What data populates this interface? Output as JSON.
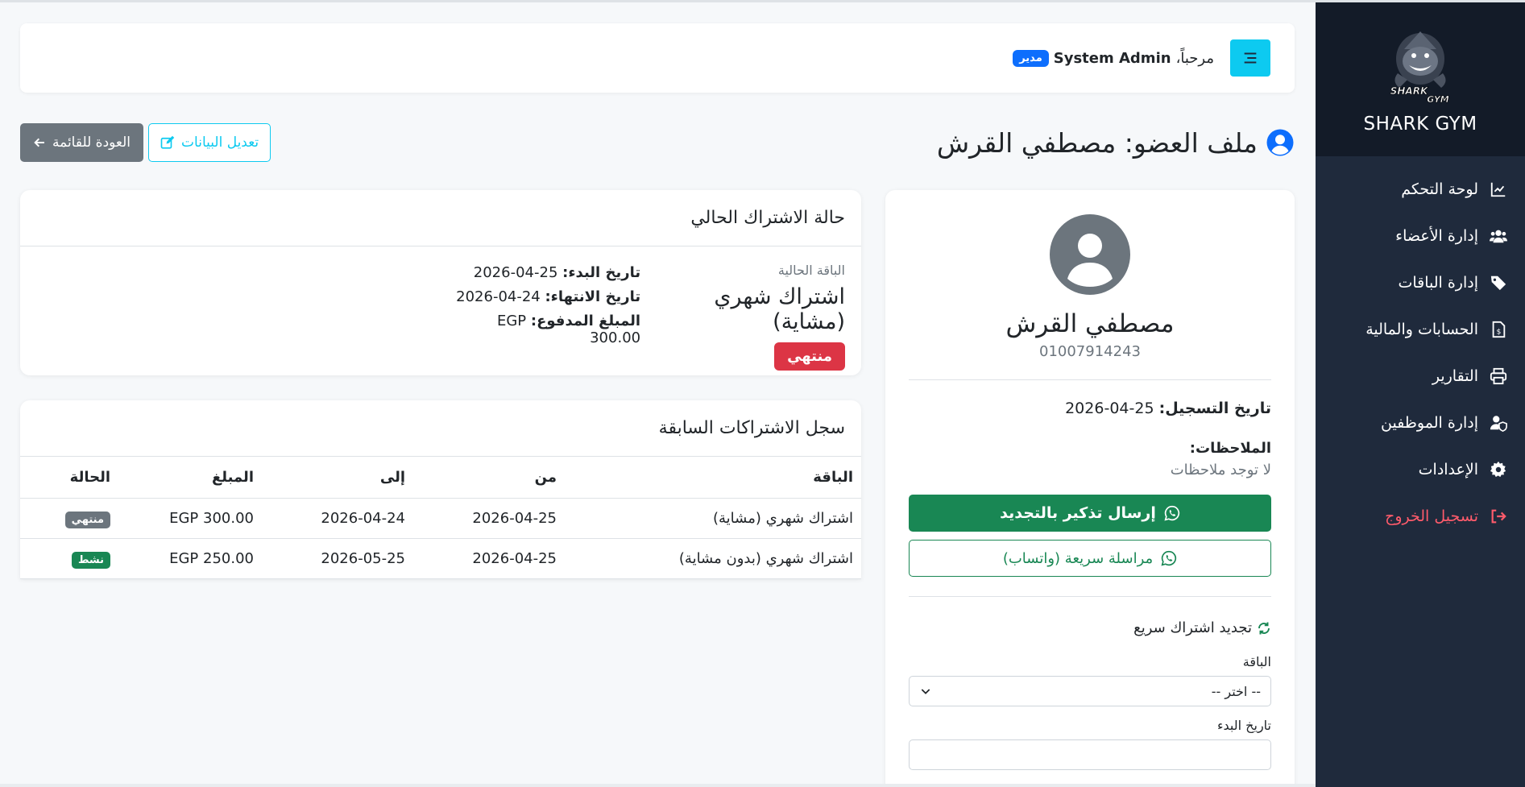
{
  "sidebar": {
    "brand": "SHARK GYM",
    "logo_text_top": "SHARK",
    "logo_text_bottom": "GYM",
    "items": [
      {
        "label": "لوحة التحكم",
        "icon": "chart-line-icon"
      },
      {
        "label": "إدارة الأعضاء",
        "icon": "users-icon"
      },
      {
        "label": "إدارة الباقات",
        "icon": "tags-icon"
      },
      {
        "label": "الحسابات والمالية",
        "icon": "invoice-dollar-icon"
      },
      {
        "label": "التقارير",
        "icon": "printer-icon"
      },
      {
        "label": "إدارة الموظفين",
        "icon": "user-shield-icon"
      },
      {
        "label": "الإعدادات",
        "icon": "gear-icon"
      },
      {
        "label": "تسجيل الخروج",
        "icon": "sign-out-icon"
      }
    ]
  },
  "topbar": {
    "greeting": "مرحباً،",
    "user": "System Admin",
    "role": "مدير"
  },
  "page": {
    "title": "ملف العضو: مصطفي القرش",
    "edit_label": "تعديل البيانات",
    "back_label": "العودة للقائمة"
  },
  "profile": {
    "name": "مصطفي القرش",
    "phone": "01007914243",
    "reg_label": "تاريخ التسجيل:",
    "reg_date": "25-04-2026",
    "notes_label": "الملاحظات:",
    "notes_value": "لا توجد ملاحظات",
    "reminder_label": "إرسال تذكير بالتجديد",
    "quick_msg_label": "مراسلة سريعة (واتساب)",
    "renew_title": "تجديد اشتراك سريع",
    "package_label": "الباقة",
    "package_select_value": "-- اختر --",
    "start_date_label": "تاريخ البدء"
  },
  "status": {
    "header": "حالة الاشتراك الحالي",
    "current_pkg_label": "الباقة الحالية",
    "current_pkg": "اشتراك شهري (مشاية)",
    "badge": "منتهي",
    "start_label": "تاريخ البدء:",
    "start_value": "25-04-2026",
    "end_label": "تاريخ الانتهاء:",
    "end_value": "24-04-2026",
    "paid_label": "المبلغ المدفوع:",
    "paid_value": "EGP 300.00"
  },
  "history": {
    "header": "سجل الاشتراكات السابقة",
    "columns": [
      "الباقة",
      "من",
      "إلى",
      "المبلغ",
      "الحالة"
    ],
    "rows": [
      {
        "pkg": "اشتراك شهري (مشاية)",
        "from": "2026-04-25",
        "to": "2026-04-24",
        "amount": "EGP 300.00",
        "status": "منتهي"
      },
      {
        "pkg": "اشتراك شهري (بدون مشاية)",
        "from": "2026-04-25",
        "to": "2026-05-25",
        "amount": "EGP 250.00",
        "status": "نشط"
      }
    ]
  },
  "colors": {
    "sidebar_bg": "#1f2a3c",
    "brand_bg": "#131b28",
    "info": "#0dcaf0",
    "danger": "#dc3545",
    "success": "#198754",
    "secondary": "#6c757d"
  }
}
